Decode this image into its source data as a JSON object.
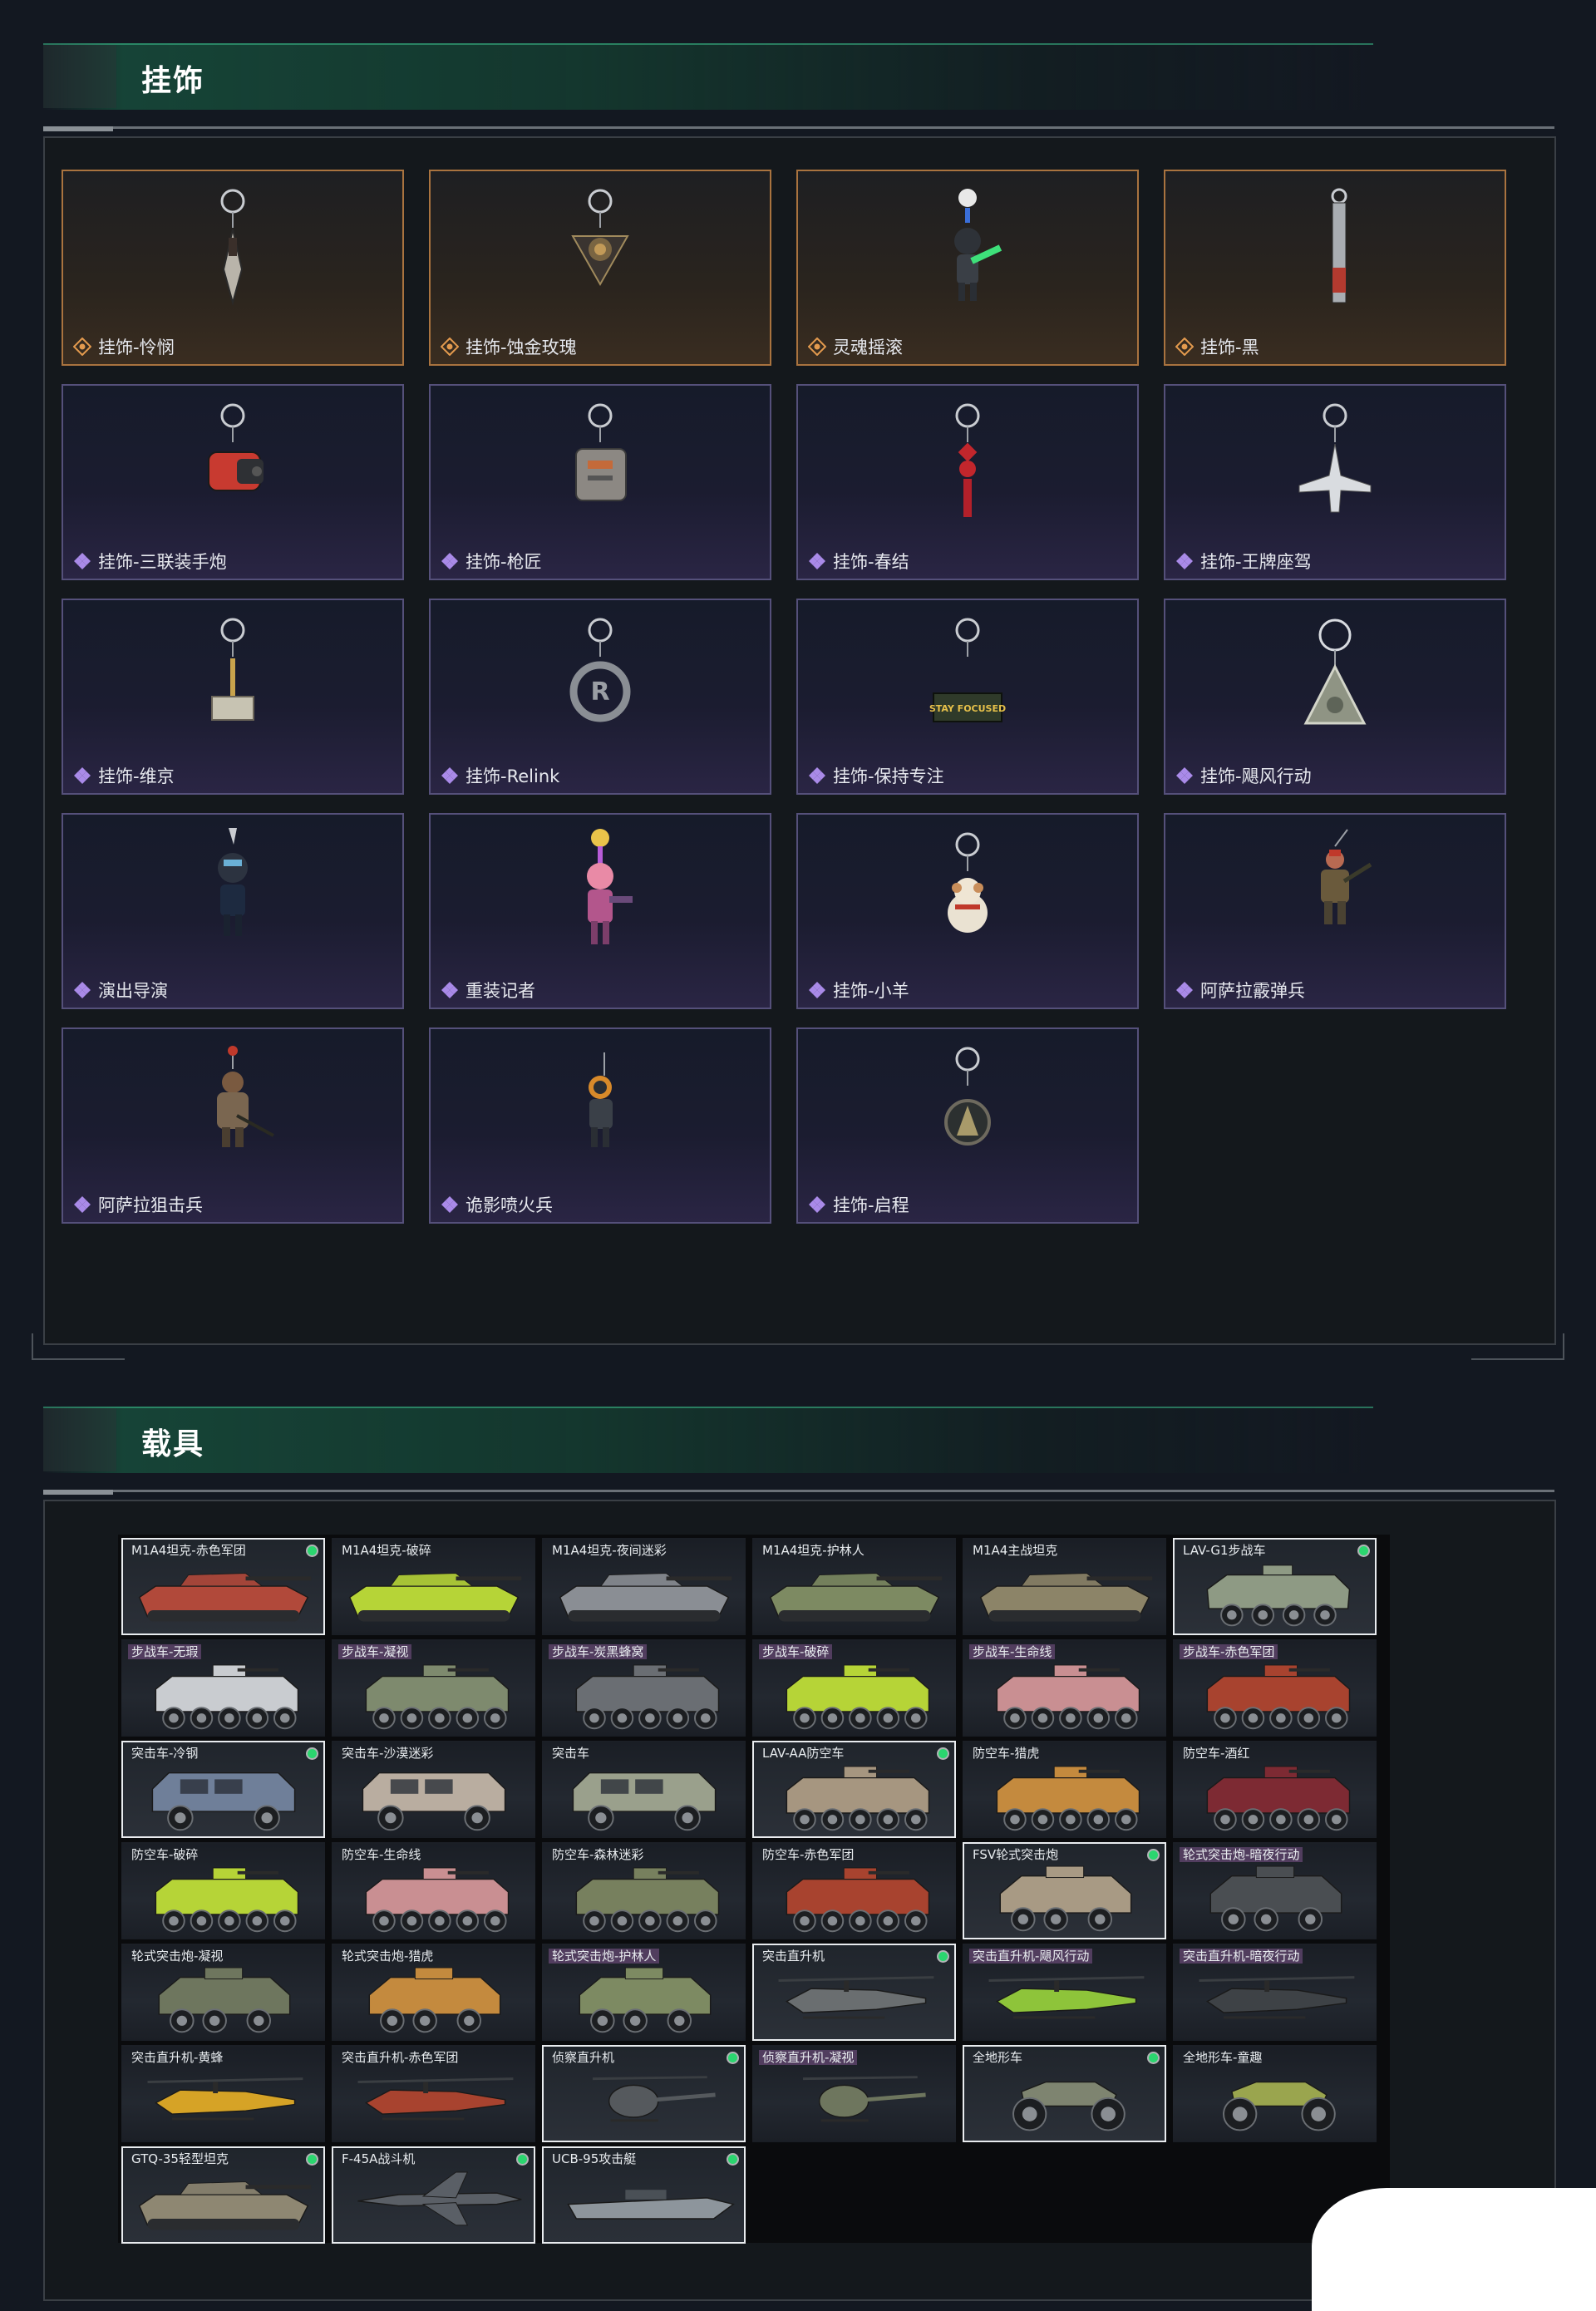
{
  "sections": {
    "charms_title": "挂饰",
    "vehicles_title": "载具"
  },
  "colors": {
    "accent_green": "#2a8f6a",
    "legendary_border": "#a9733f",
    "epic_border": "#55507a",
    "legendary_icon": "#e39a4e",
    "epic_icon": "#a98ae8",
    "owned_dot": "#2bd66f"
  },
  "charms": [
    {
      "name": "挂饰-怜悯",
      "rarity": "gold",
      "art": "kunai"
    },
    {
      "name": "挂饰-蚀金玫瑰",
      "rarity": "gold",
      "art": "rose"
    },
    {
      "name": "灵魂摇滚",
      "rarity": "gold",
      "art": "guitarist"
    },
    {
      "name": "挂饰-黑",
      "rarity": "gold",
      "art": "stick"
    },
    {
      "name": "挂饰-三联装手炮",
      "rarity": "epic",
      "art": "cannon"
    },
    {
      "name": "挂饰-枪匠",
      "rarity": "epic",
      "art": "box"
    },
    {
      "name": "挂饰-春结",
      "rarity": "epic",
      "art": "knot"
    },
    {
      "name": "挂饰-王牌座驾",
      "rarity": "epic",
      "art": "jet"
    },
    {
      "name": "挂饰-维京",
      "rarity": "epic",
      "art": "hammer"
    },
    {
      "name": "挂饰-Relink",
      "rarity": "epic",
      "art": "ring"
    },
    {
      "name": "挂饰-保持专注",
      "rarity": "epic",
      "art": "sign"
    },
    {
      "name": "挂饰-飓风行动",
      "rarity": "epic",
      "art": "triangle"
    },
    {
      "name": "演出导演",
      "rarity": "epic",
      "art": "figure-blue"
    },
    {
      "name": "重装记者",
      "rarity": "epic",
      "art": "figure-pink"
    },
    {
      "name": "挂饰-小羊",
      "rarity": "epic",
      "art": "sheep"
    },
    {
      "name": "阿萨拉霰弹兵",
      "rarity": "epic",
      "art": "soldier-red"
    },
    {
      "name": "阿萨拉狙击兵",
      "rarity": "epic",
      "art": "soldier-brown"
    },
    {
      "name": "诡影喷火兵",
      "rarity": "epic",
      "art": "figure-orange"
    },
    {
      "name": "挂饰-启程",
      "rarity": "epic",
      "art": "medallion"
    }
  ],
  "charm_sign_text": "STAY FOCUSED",
  "vehicles": [
    {
      "name": "M1A4坦克-赤色军团",
      "kind": "tank",
      "color": "#b1493a",
      "selected": true,
      "owned": true,
      "tag": false
    },
    {
      "name": "M1A4坦克-破碎",
      "kind": "tank",
      "color": "#b6d437",
      "selected": false,
      "owned": false,
      "tag": false
    },
    {
      "name": "M1A4坦克-夜间迷彩",
      "kind": "tank",
      "color": "#8a8e94",
      "selected": false,
      "owned": false,
      "tag": false
    },
    {
      "name": "M1A4坦克-护林人",
      "kind": "tank",
      "color": "#7d8a62",
      "selected": false,
      "owned": false,
      "tag": false
    },
    {
      "name": "M1A4主战坦克",
      "kind": "tank",
      "color": "#8c8468",
      "selected": false,
      "owned": false,
      "tag": false
    },
    {
      "name": "LAV-G1步战车",
      "kind": "apc6",
      "color": "#8e9a84",
      "selected": true,
      "owned": true,
      "tag": false
    },
    {
      "name": "步战车-无瑕",
      "kind": "ifv",
      "color": "#c9ccd0",
      "selected": false,
      "owned": false,
      "tag": true
    },
    {
      "name": "步战车-凝视",
      "kind": "ifv",
      "color": "#7e8a6e",
      "selected": false,
      "owned": false,
      "tag": true
    },
    {
      "name": "步战车-炭黑蜂窝",
      "kind": "ifv",
      "color": "#6a6e73",
      "selected": false,
      "owned": false,
      "tag": true
    },
    {
      "name": "步战车-破碎",
      "kind": "ifv",
      "color": "#b6d437",
      "selected": false,
      "owned": false,
      "tag": true
    },
    {
      "name": "步战车-生命线",
      "kind": "ifv",
      "color": "#c98f92",
      "selected": false,
      "owned": false,
      "tag": true
    },
    {
      "name": "步战车-赤色军团",
      "kind": "ifv",
      "color": "#a8432f",
      "selected": false,
      "owned": false,
      "tag": true
    },
    {
      "name": "突击车-冷钢",
      "kind": "truck",
      "color": "#6f7f99",
      "selected": true,
      "owned": true,
      "tag": false
    },
    {
      "name": "突击车-沙漠迷彩",
      "kind": "truck",
      "color": "#b9ada0",
      "selected": false,
      "owned": false,
      "tag": false
    },
    {
      "name": "突击车",
      "kind": "truck",
      "color": "#9aa08c",
      "selected": false,
      "owned": false,
      "tag": false
    },
    {
      "name": "LAV-AA防空车",
      "kind": "apc8",
      "color": "#a69680",
      "selected": true,
      "owned": true,
      "tag": false
    },
    {
      "name": "防空车-猎虎",
      "kind": "apc8",
      "color": "#c48a3e",
      "selected": false,
      "owned": false,
      "tag": false
    },
    {
      "name": "防空车-酒红",
      "kind": "apc8",
      "color": "#7d2a33",
      "selected": false,
      "owned": false,
      "tag": false
    },
    {
      "name": "防空车-破碎",
      "kind": "apc8",
      "color": "#b6d437",
      "selected": false,
      "owned": false,
      "tag": false
    },
    {
      "name": "防空车-生命线",
      "kind": "apc8",
      "color": "#c98f92",
      "selected": false,
      "owned": false,
      "tag": false
    },
    {
      "name": "防空车-森林迷彩",
      "kind": "apc8",
      "color": "#77805e",
      "selected": false,
      "owned": false,
      "tag": false
    },
    {
      "name": "防空车-赤色军团",
      "kind": "apc8",
      "color": "#a8432f",
      "selected": false,
      "owned": false,
      "tag": false
    },
    {
      "name": "FSV轮式突击炮",
      "kind": "armoredcar",
      "color": "#a89a84",
      "selected": true,
      "owned": true,
      "tag": false
    },
    {
      "name": "轮式突击炮-暗夜行动",
      "kind": "armoredcar",
      "color": "#4a4e52",
      "selected": false,
      "owned": false,
      "tag": true
    },
    {
      "name": "轮式突击炮-凝视",
      "kind": "armoredcar",
      "color": "#6e765e",
      "selected": false,
      "owned": false,
      "tag": false
    },
    {
      "name": "轮式突击炮-猎虎",
      "kind": "armoredcar",
      "color": "#c48a3e",
      "selected": false,
      "owned": false,
      "tag": false
    },
    {
      "name": "轮式突击炮-护林人",
      "kind": "armoredcar",
      "color": "#7d8a62",
      "selected": false,
      "owned": false,
      "tag": true
    },
    {
      "name": "突击直升机",
      "kind": "heli",
      "color": "#6a6e70",
      "selected": true,
      "owned": true,
      "tag": false
    },
    {
      "name": "突击直升机-飓风行动",
      "kind": "heli",
      "color": "#8ec43a",
      "selected": false,
      "owned": false,
      "tag": true
    },
    {
      "name": "突击直升机-暗夜行动",
      "kind": "heli",
      "color": "#3e4246",
      "selected": false,
      "owned": false,
      "tag": true
    },
    {
      "name": "突击直升机-黄蜂",
      "kind": "heli",
      "color": "#d6a326",
      "selected": false,
      "owned": false,
      "tag": false
    },
    {
      "name": "突击直升机-赤色军团",
      "kind": "heli",
      "color": "#a8432f",
      "selected": false,
      "owned": false,
      "tag": false
    },
    {
      "name": "侦察直升机",
      "kind": "scout",
      "color": "#55595d",
      "selected": true,
      "owned": true,
      "tag": false
    },
    {
      "name": "侦察直升机-凝视",
      "kind": "scout",
      "color": "#6e765e",
      "selected": false,
      "owned": false,
      "tag": true
    },
    {
      "name": "全地形车",
      "kind": "atv",
      "color": "#7e8470",
      "selected": true,
      "owned": true,
      "tag": false
    },
    {
      "name": "全地形车-童趣",
      "kind": "atv",
      "color": "#9aa54e",
      "selected": false,
      "owned": false,
      "tag": false
    },
    {
      "name": "GTQ-35轻型坦克",
      "kind": "tank",
      "color": "#8e8772",
      "selected": true,
      "owned": true,
      "tag": false
    },
    {
      "name": "F-45A战斗机",
      "kind": "jet",
      "color": "#5a5f66",
      "selected": true,
      "owned": true,
      "tag": false
    },
    {
      "name": "UCB-95攻击艇",
      "kind": "boat",
      "color": "#8d959c",
      "selected": true,
      "owned": true,
      "tag": false
    }
  ]
}
